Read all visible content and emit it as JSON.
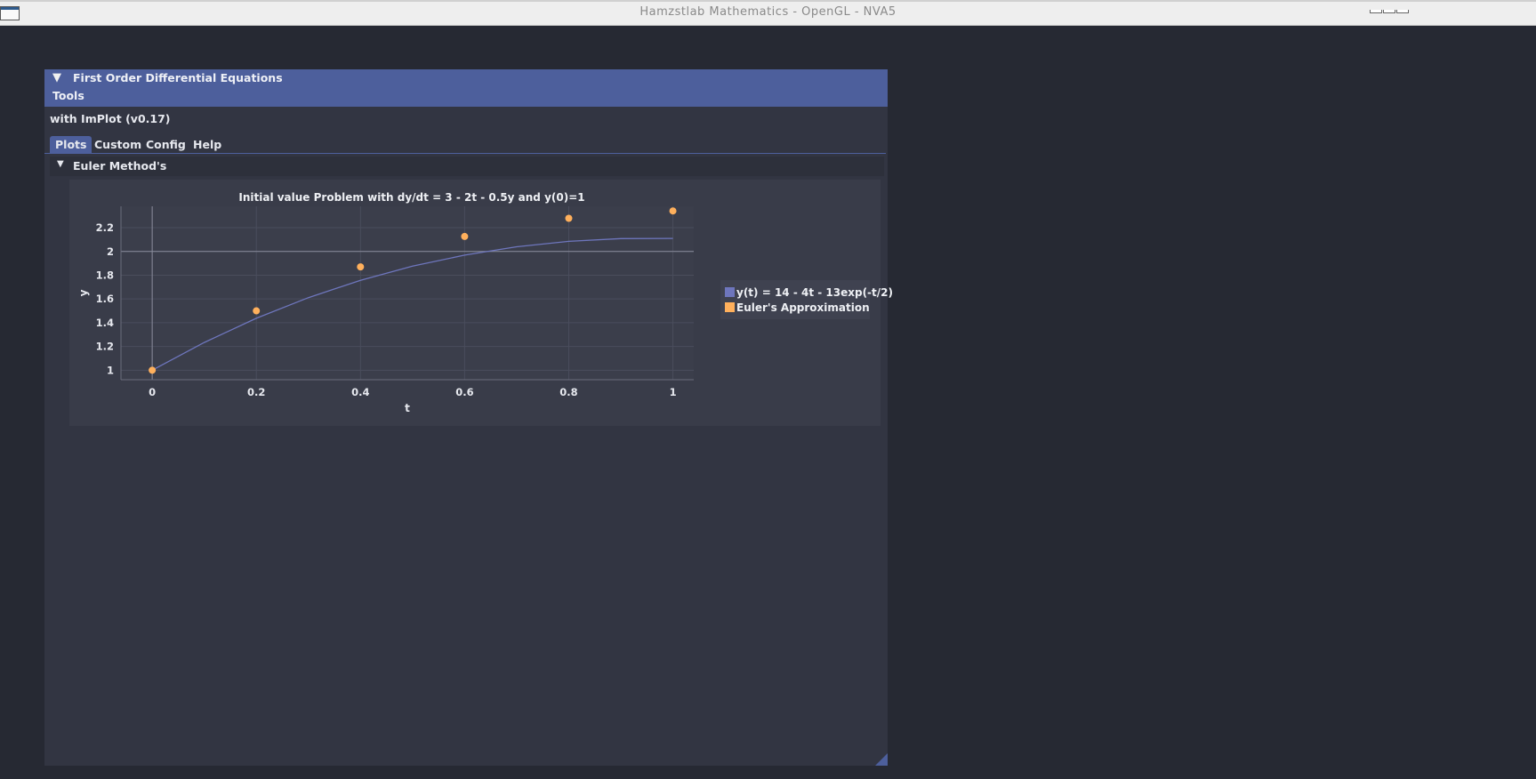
{
  "os_window": {
    "title": "Hamzstlab Mathematics - OpenGL - NVA5"
  },
  "panel": {
    "title": "First Order Differential Equations",
    "menu_tools": "Tools",
    "subtitle": "with ImPlot (v0.17)",
    "tabs": [
      "Plots",
      "Custom",
      "Config",
      "Help"
    ],
    "active_tab": "Plots",
    "section_label": "Euler Method's",
    "header_color": "#4d5f9c"
  },
  "chart_data": {
    "type": "line",
    "title": "Initial value Problem with dy/dt = 3 - 2t - 0.5y and y(0)=1",
    "xlabel": "t",
    "ylabel": "y",
    "xlim": [
      -0.06,
      1.04
    ],
    "ylim": [
      0.92,
      2.38
    ],
    "x_ticks": [
      0,
      0.2,
      0.4,
      0.6,
      0.8,
      1
    ],
    "x_tick_labels": [
      "0",
      "0.2",
      "0.4",
      "0.6",
      "0.8",
      "1"
    ],
    "y_ticks": [
      1,
      1.2,
      1.4,
      1.6,
      1.8,
      2,
      2.2
    ],
    "y_tick_labels": [
      "1",
      "1.2",
      "1.4",
      "1.6",
      "1.8",
      "2",
      "2.2"
    ],
    "grid": true,
    "legend_position": "right",
    "series": [
      {
        "name": "y(t) = 14 - 4t - 13exp(-t/2)",
        "kind": "line",
        "color": "#6e76bd",
        "x": [
          0,
          0.1,
          0.2,
          0.3,
          0.4,
          0.5,
          0.6,
          0.7,
          0.8,
          0.9,
          1.0
        ],
        "y": [
          1.0,
          1.234,
          1.437,
          1.611,
          1.757,
          1.876,
          1.969,
          2.039,
          2.085,
          2.108,
          2.11
        ]
      },
      {
        "name": "Euler's Approximation",
        "kind": "scatter",
        "color": "#ffb05c",
        "x": [
          0,
          0.2,
          0.4,
          0.6,
          0.8,
          1.0
        ],
        "y": [
          1.0,
          1.5,
          1.87,
          2.126,
          2.279,
          2.341
        ]
      }
    ]
  }
}
